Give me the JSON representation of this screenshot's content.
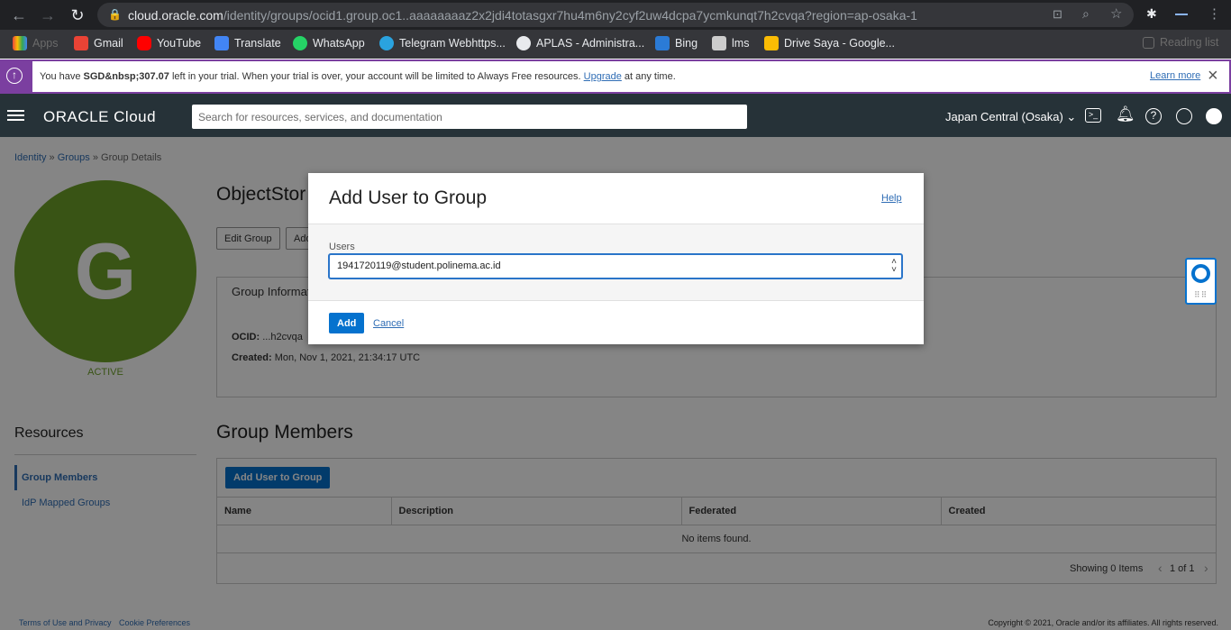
{
  "browser": {
    "url_host": "cloud.oracle.com",
    "url_rest": "/identity/groups/ocid1.group.oc1..aaaaaaaaz2x2jdi4totasgxr7hu4m6ny2cyf2uw4dcpa7ycmkunqt7h2cvqa?region=ap-osaka-1",
    "bookmarks": [
      {
        "label": "Apps",
        "color": "#e8453c"
      },
      {
        "label": "Gmail",
        "color": "#ea4335"
      },
      {
        "label": "YouTube",
        "color": "#ff0000"
      },
      {
        "label": "Translate",
        "color": "#4285f4"
      },
      {
        "label": "WhatsApp",
        "color": "#25d366"
      },
      {
        "label": "Telegram Webhttps...",
        "color": "#2aa3df"
      },
      {
        "label": "APLAS - Administra...",
        "color": "#e8eaed"
      },
      {
        "label": "Bing",
        "color": "#2b7bd6"
      },
      {
        "label": "lms",
        "color": "#cccccc"
      },
      {
        "label": "Drive Saya - Google...",
        "color": "#fbbc04"
      }
    ],
    "reading_list": "Reading list"
  },
  "trial": {
    "text_a": "You have ",
    "amount": "SGD&nbsp;307.07",
    "text_b": " left in your trial. When your trial is over, your account will be limited to Always Free resources. ",
    "upgrade": "Upgrade",
    "text_c": " at any time.",
    "learn_more": "Learn more"
  },
  "header": {
    "brand": "ORACLE",
    "brand_suffix": "Cloud",
    "search_placeholder": "Search for resources, services, and documentation",
    "region": "Japan Central (Osaka)"
  },
  "breadcrumb": {
    "identity": "Identity",
    "groups": "Groups",
    "current": "Group Details",
    "sep": "»"
  },
  "group": {
    "letter": "G",
    "status": "ACTIVE",
    "title": "ObjectStor",
    "edit_btn": "Edit Group",
    "add_btn": "Add",
    "info_tab": "Group Informat",
    "ocid_label": "OCID:",
    "ocid_value": "...h2cvqa",
    "created_label": "Created:",
    "created_value": "Mon, Nov 1, 2021, 21:34:17 UTC"
  },
  "resources": {
    "title": "Resources",
    "items": [
      "Group Members",
      "IdP Mapped Groups"
    ]
  },
  "members": {
    "title": "Group Members",
    "add_btn": "Add User to Group",
    "columns": [
      "Name",
      "Description",
      "Federated",
      "Created"
    ],
    "empty": "No items found.",
    "showing": "Showing 0 Items",
    "pager": "1 of 1"
  },
  "footer": {
    "terms": "Terms of Use and Privacy",
    "cookies": "Cookie Preferences",
    "copyright": "Copyright © 2021, Oracle and/or its affiliates. All rights reserved."
  },
  "modal": {
    "title": "Add User to Group",
    "help": "Help",
    "users_label": "Users",
    "users_value": "1941720119@student.polinema.ac.id",
    "add": "Add",
    "cancel": "Cancel"
  },
  "colors": {
    "accent": "#0572ce",
    "avatar": "#6ea22a",
    "header": "#263238",
    "trial_border": "#7b3fa0"
  }
}
